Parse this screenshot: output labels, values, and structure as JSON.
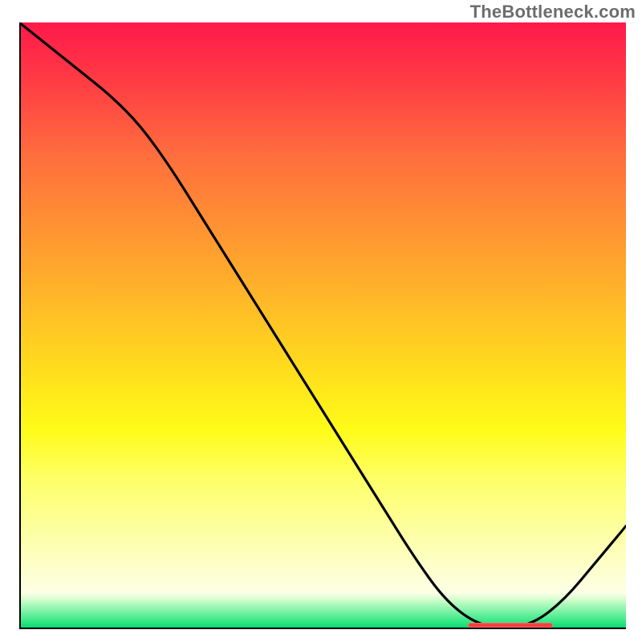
{
  "attribution": "TheBottleneck.com",
  "chart_data": {
    "type": "line",
    "title": "",
    "xlabel": "",
    "ylabel": "",
    "xlim": [
      0,
      100
    ],
    "ylim": [
      0,
      100
    ],
    "series": [
      {
        "name": "bottleneck-curve",
        "x": [
          0,
          5,
          10,
          15,
          20,
          25,
          30,
          35,
          40,
          45,
          50,
          55,
          60,
          65,
          70,
          75,
          80,
          85,
          90,
          95,
          100
        ],
        "y": [
          100,
          96,
          92,
          88,
          83,
          76,
          68,
          60,
          52,
          44,
          36,
          28,
          20,
          12,
          5,
          1,
          0,
          1,
          5,
          11,
          17
        ]
      }
    ],
    "annotations": [
      {
        "name": "optimal-range-marker",
        "x_start": 74,
        "x_end": 88,
        "y": 0.7
      }
    ],
    "colors": {
      "curve": "#000000",
      "marker": "#ff3b3b",
      "gradient_top": "#ff194a",
      "gradient_bottom": "#00d173"
    }
  }
}
